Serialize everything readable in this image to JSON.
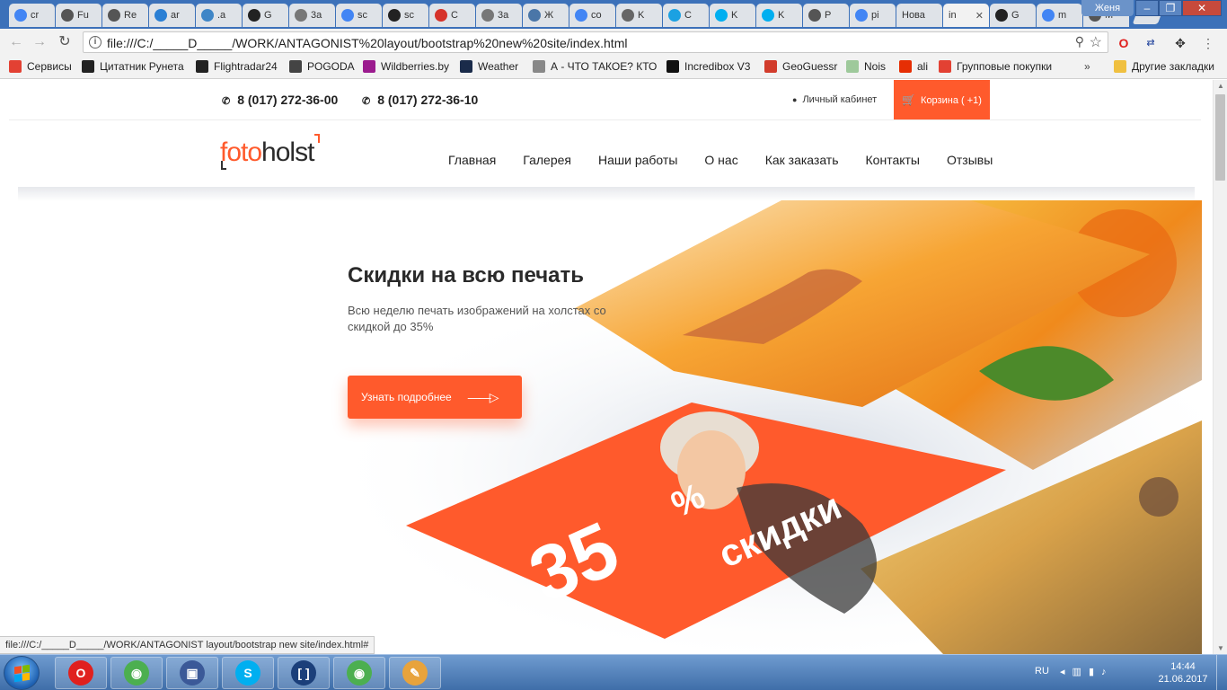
{
  "browser": {
    "tabs": [
      {
        "label": "cr",
        "icon": "google-icon",
        "color": "#4285f4"
      },
      {
        "label": "Fu",
        "icon": "codepen-icon",
        "color": "#555555"
      },
      {
        "label": "Re",
        "icon": "codepen-icon",
        "color": "#555555"
      },
      {
        "label": "ar",
        "icon": "photo-icon",
        "color": "#2a7fd4"
      },
      {
        "label": ".a",
        "icon": "wave-icon",
        "color": "#3f86c7"
      },
      {
        "label": "G",
        "icon": "github-icon",
        "color": "#222222"
      },
      {
        "label": "3a",
        "icon": "doc-icon",
        "color": "#777777"
      },
      {
        "label": "sc",
        "icon": "google-icon",
        "color": "#4285f4"
      },
      {
        "label": "sc",
        "icon": "github-icon",
        "color": "#222222"
      },
      {
        "label": "C",
        "icon": "opera-news-icon",
        "color": "#d6332a"
      },
      {
        "label": "3a",
        "icon": "doc-icon",
        "color": "#777777"
      },
      {
        "label": "Ж",
        "icon": "vk-icon",
        "color": "#4a76a8"
      },
      {
        "label": "co",
        "icon": "google-icon",
        "color": "#4285f4"
      },
      {
        "label": "K",
        "icon": "avatar-icon",
        "color": "#666666"
      },
      {
        "label": "C",
        "icon": "settings-icon",
        "color": "#1ba1e2"
      },
      {
        "label": "K",
        "icon": "skype-icon",
        "color": "#00aff0"
      },
      {
        "label": "K",
        "icon": "skype-icon",
        "color": "#00aff0"
      },
      {
        "label": "P",
        "icon": "codepen-icon",
        "color": "#555555"
      },
      {
        "label": "pi",
        "icon": "google-icon",
        "color": "#4285f4"
      },
      {
        "label": "Нова",
        "icon": "none",
        "color": "#dfe3e8"
      },
      {
        "label": "in",
        "icon": "none",
        "color": "#dfe3e8",
        "active": true,
        "close": "✕"
      },
      {
        "label": "G",
        "icon": "github-icon",
        "color": "#222222"
      },
      {
        "label": "m",
        "icon": "google-icon",
        "color": "#4285f4"
      },
      {
        "label": "M",
        "icon": "image-icon",
        "color": "#555555"
      }
    ],
    "user": "Женя",
    "window_controls": {
      "minimize": "–",
      "maximize": "❐",
      "close": "✕"
    },
    "url": "file:///C:/_____D_____/WORK/ANTAGONIST%20layout/bootstrap%20new%20site/index.html",
    "bookmarks": [
      {
        "label": "Сервисы",
        "icon": "apps-icon",
        "color": "#e34133"
      },
      {
        "label": "Цитатник Рунета",
        "icon": "b-icon",
        "color": "#222222"
      },
      {
        "label": "Flightradar24",
        "icon": "radar-icon",
        "color": "#222222"
      },
      {
        "label": "POGODA",
        "icon": "weather-small-icon",
        "color": "#444444"
      },
      {
        "label": "Wildberries.by",
        "icon": "wildberries-icon",
        "color": "#9b1b8e"
      },
      {
        "label": "Weather",
        "icon": "weather-icon",
        "color": "#1a2b4a"
      },
      {
        "label": "А - ЧТО ТАКОЕ? КТО",
        "icon": "page-icon",
        "color": "#888888"
      },
      {
        "label": "Incredibox V3",
        "icon": "music-icon",
        "color": "#111111"
      },
      {
        "label": "GeoGuessr",
        "icon": "pin-icon",
        "color": "#d23c2c"
      },
      {
        "label": "Nois",
        "icon": "noise-icon",
        "color": "#9ec99b"
      },
      {
        "label": "ali",
        "icon": "ali-icon",
        "color": "#e62e04"
      },
      {
        "label": "Групповые покупки",
        "icon": "group-icon",
        "color": "#e34133"
      },
      {
        "label": "Другие закладки",
        "icon": "folder-icon",
        "color": "#f0c040"
      }
    ],
    "bookmarks_more": "»",
    "status_url": "file:///C:/_____D_____/WORK/ANTAGONIST layout/bootstrap new site/index.html#"
  },
  "site": {
    "phones": [
      "8 (017) 272-36-00",
      "8 (017) 272-36-10"
    ],
    "cabinet": "Личный кабинет",
    "cart": "Корзина ( +1)",
    "logo_a": "foto",
    "logo_b": "holst",
    "menu": [
      "Главная",
      "Галерея",
      "Наши работы",
      "О нас",
      "Как заказать",
      "Контакты",
      "Отзывы"
    ],
    "hero": {
      "title": "Скидки на всю печать",
      "subtitle": "Всю неделю печать изображений на холстах со скидкой до 35%",
      "button": "Узнать подробнее",
      "promo_number": "35",
      "promo_percent": "%",
      "promo_word": "скидки"
    },
    "accent": "#ff5a2c"
  },
  "taskbar": {
    "apps": [
      "opera-icon",
      "chrome-icon",
      "save-icon",
      "skype-icon",
      "bracket-icon",
      "chrome-icon",
      "paint-icon"
    ],
    "lang": "RU",
    "time": "14:44",
    "date": "21.06.2017"
  }
}
